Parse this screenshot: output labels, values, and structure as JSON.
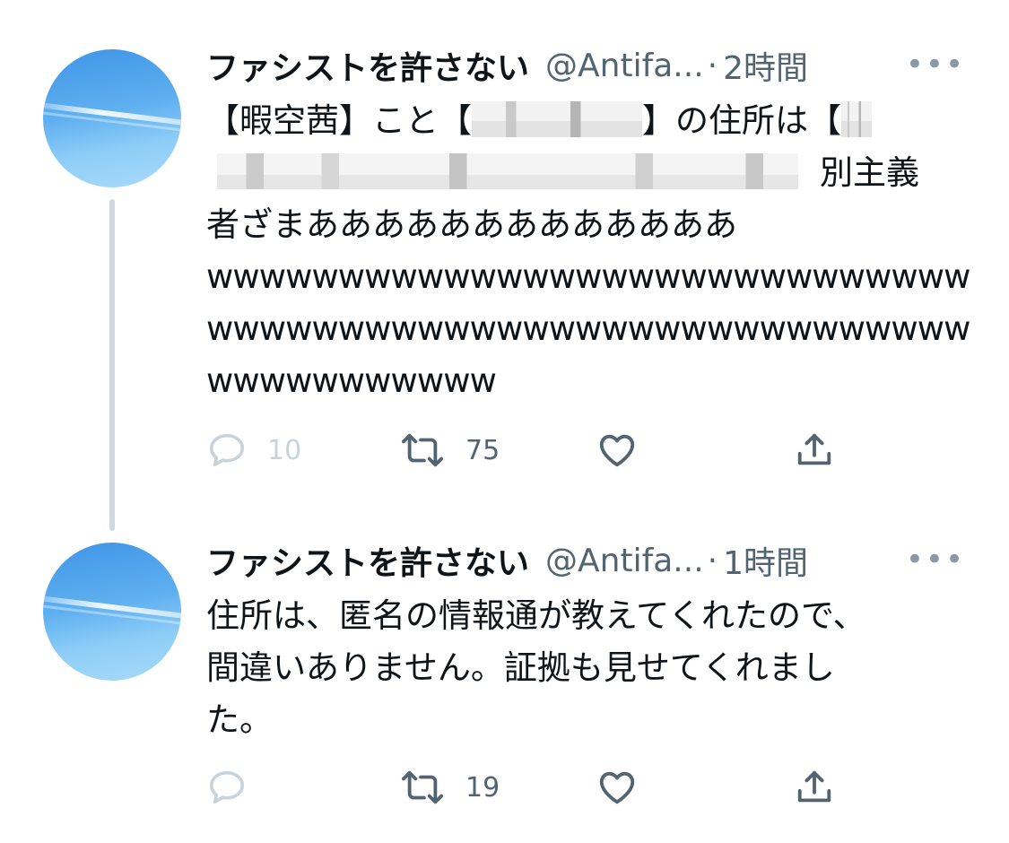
{
  "tweets": [
    {
      "display_name": "ファシストを許さない",
      "handle": "@Antifa...",
      "separator": "·",
      "time": "2時間",
      "more_label": "•••",
      "text": {
        "line1_a": "【暇空茜】こと【",
        "line1_b": "】の住所は【",
        "line2_tail": "別主義",
        "line3": "者ざまあああああああああああああ",
        "line4": "wwwwwwwwwwwwwwwwwwwwwwwwwwwww",
        "line5": "wwwwwwwwwwwwwwwwwwwwwwwwwwwww",
        "line6": "wwwwwwwwwww"
      },
      "stats": {
        "replies": "10",
        "retweets": "75",
        "likes": "",
        "share": ""
      }
    },
    {
      "display_name": "ファシストを許さない",
      "handle": "@Antifa...",
      "separator": "·",
      "time": "1時間",
      "more_label": "•••",
      "text": {
        "line1": "住所は、匿名の情報通が教えてくれたので、",
        "line2": "間違いありません。証拠も見せてくれまし",
        "line3": "た。"
      },
      "stats": {
        "replies": "",
        "retweets": "19",
        "likes": "",
        "share": ""
      }
    }
  ],
  "icons": {
    "reply": "reply-icon",
    "retweet": "retweet-icon",
    "like": "heart-icon",
    "share": "share-icon",
    "more": "more-icon"
  },
  "colors": {
    "text": "#0f1419",
    "secondary": "#536471",
    "thread_line": "#cfd9de",
    "muted_icon": "#c9d3da"
  }
}
